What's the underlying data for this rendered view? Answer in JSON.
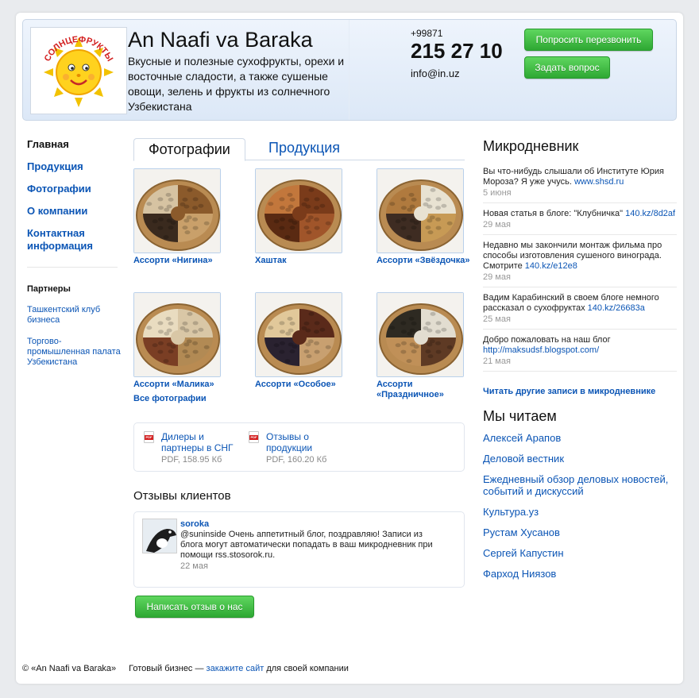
{
  "header": {
    "logo_text": "СОЛНЦЕФРУКТЫ",
    "title": "An Naafi va Baraka",
    "description": "Вкусные и полезные сухофрукты, орехи и восточные сладости, а также сушеные овощи, зелень и фрукты из солнечного Узбекистана",
    "phone_prefix": "+99871",
    "phone": "215 27 10",
    "email": "info@in.uz",
    "callback_label": "Попросить перезвонить",
    "ask_label": "Задать вопрос"
  },
  "nav": {
    "items": [
      {
        "label": "Главная"
      },
      {
        "label": "Продукция"
      },
      {
        "label": "Фотографии"
      },
      {
        "label": "О компании"
      },
      {
        "label": "Контактная информация"
      }
    ]
  },
  "partners": {
    "heading": "Партнеры",
    "items": [
      {
        "label": "Ташкентский клуб бизнеса"
      },
      {
        "label": "Торгово-промышленная палата Узбекистана"
      }
    ]
  },
  "tabs": {
    "active": "Фотографии",
    "other": "Продукция"
  },
  "photos": [
    {
      "caption": "Ассорти «Нигина»",
      "palette": [
        "#8b5a2b",
        "#c9a06a",
        "#3a2a1e",
        "#d6c3a2"
      ]
    },
    {
      "caption": "Хаштак",
      "palette": [
        "#7a3b1a",
        "#a0552a",
        "#5a2a12",
        "#c2773c"
      ]
    },
    {
      "caption": "Ассорти «Звёздочка»",
      "palette": [
        "#e8e2d2",
        "#c79a55",
        "#3e2c22",
        "#b07a3e"
      ]
    },
    {
      "caption": "Ассорти «Малика»",
      "palette": [
        "#d9c7a6",
        "#b28a54",
        "#7a3e24",
        "#e9dcc0"
      ]
    },
    {
      "caption": "Ассорти «Особое»",
      "palette": [
        "#5a2a1a",
        "#c8a070",
        "#2a2230",
        "#e1c89a"
      ]
    },
    {
      "caption": "Ассорти «Праздничное»",
      "palette": [
        "#e2ddd0",
        "#5e3a24",
        "#c09058",
        "#2e2a22"
      ]
    }
  ],
  "all_photos_label": "Все фотографии",
  "files": [
    {
      "name": "Дилеры и партнеры в СНГ",
      "meta": "PDF, 158.95 Кб",
      "badge": "PDF"
    },
    {
      "name": "Отзывы о продукции",
      "meta": "PDF, 160.20 Кб",
      "badge": "PDF"
    }
  ],
  "reviews": {
    "heading": "Отзывы клиентов",
    "items": [
      {
        "user": "soroka",
        "text": "@suninside Очень аппетитный блог, поздравляю! Записи из блога могут автоматически попадать в ваш микродневник при помощи rss.stosorok.ru.",
        "date": "22 мая"
      }
    ],
    "write_label": "Написать отзыв о нас"
  },
  "micro": {
    "heading": "Микродневник",
    "posts": [
      {
        "text": "Вы что-нибудь слышали об Институте Юрия Мороза? Я уже учусь.",
        "link": "www.shsd.ru",
        "date": "5 июня"
      },
      {
        "text": "Новая статья в блоге: \"Клубничка\"",
        "link": "140.kz/8d2af",
        "date": "29 мая"
      },
      {
        "text": "Недавно мы закончили монтаж фильма про способы изготовления сушеного винограда. Смотрите",
        "link": "140.kz/e12e8",
        "date": "29 мая"
      },
      {
        "text": "Вадим Карабинский в своем блоге немного рассказал о сухофруктах",
        "link": "140.kz/26683a",
        "date": "25 мая"
      },
      {
        "text": "Добро пожаловать на наш блог",
        "link": "http://maksudsf.blogspot.com/",
        "date": "21 мая"
      }
    ],
    "more_label": "Читать другие записи в микродневнике"
  },
  "reading": {
    "heading": "Мы читаем",
    "items": [
      {
        "label": "Алексей Арапов"
      },
      {
        "label": "Деловой вестник"
      },
      {
        "label": "Ежедневный обзор деловых новостей, событий и дискуссий"
      },
      {
        "label": "Культура.уз"
      },
      {
        "label": "Рустам Хусанов"
      },
      {
        "label": "Сергей Капустин"
      },
      {
        "label": "Фарход Ниязов"
      }
    ]
  },
  "footer": {
    "copyright": "© «An Naafi va Baraka»",
    "text_before": "Готовый бизнес — ",
    "link": "закажите сайт",
    "text_after": " для своей компании"
  }
}
